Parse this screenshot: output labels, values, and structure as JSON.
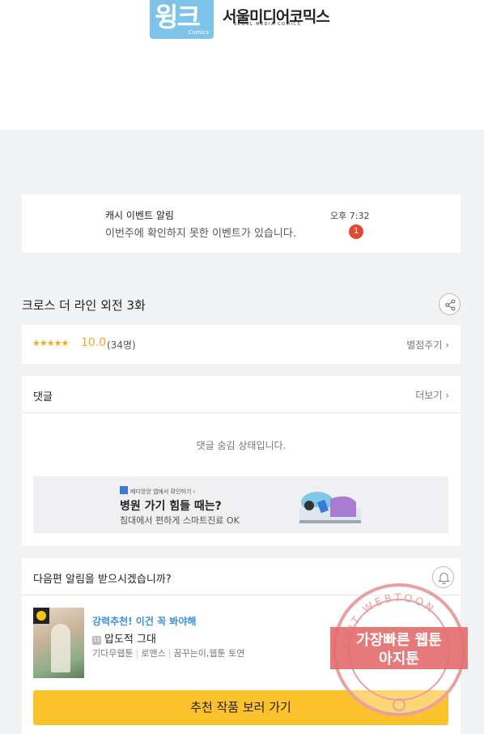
{
  "header": {
    "logo_text": "윙크",
    "logo_sub": "Comics",
    "brand": "서울미디어코믹스",
    "brand_sub": "SEOUL MEDIA COMICS"
  },
  "notice": {
    "title": "캐시 이벤트 알림",
    "message": "이번주에 확인하지 못한 이벤트가 있습니다.",
    "time": "오후 7:32",
    "badge": "1"
  },
  "episode": {
    "title": "크로스 더 라인 외전 3화",
    "share_icon": "share-icon"
  },
  "rating": {
    "stars": "★★★★★",
    "score": "10.0",
    "count": "(34명)",
    "rate_label": "별점주기 ›"
  },
  "comments": {
    "header": "댓글",
    "more": "더보기 ›",
    "hidden_text": "댓글 숨김 상태입니다."
  },
  "ad": {
    "small": "메디앙앙 앱에서 확인하기 ›",
    "title": "병원 가기 힘들 때는?",
    "subtitle": "침대에서 편하게 스마트진료 OK"
  },
  "next_episode": {
    "question": "다음편 알림을 받으시겠습니까?",
    "bell_icon": "bell-icon",
    "recommend": "강력추천! 이건 꼭 봐야해",
    "age": "15",
    "work_title": "압도적 그대",
    "tags": [
      "기다무웹툰",
      "로맨스",
      "꿈꾸는이,웹툰 토연"
    ],
    "button": "추천 작품 보러 가기"
  },
  "watermark": {
    "top": "AGIT WEBTOON",
    "line1": "가장빠른 웹툰",
    "line2": "아지툰"
  },
  "colors": {
    "accent_yellow": "#fcc22b",
    "star": "#f5a623",
    "badge_red": "#e24a2f",
    "link_blue": "#3a8ee6"
  }
}
